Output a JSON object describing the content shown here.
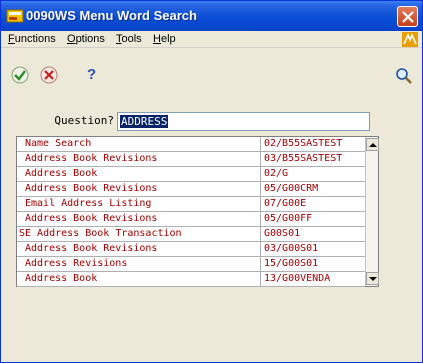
{
  "window": {
    "title": "0090WS   Menu Word Search"
  },
  "menubar": {
    "items": [
      "Functions",
      "Options",
      "Tools",
      "Help"
    ]
  },
  "toolbar": {
    "ok": "checkmark-icon",
    "cancel": "cancel-icon",
    "help": "?",
    "search": "magnifier-icon"
  },
  "question": {
    "label": "Question?",
    "value": "ADDRESS"
  },
  "results": [
    {
      "name": "Name Search",
      "code": "02/B55SASTEST",
      "indent": true
    },
    {
      "name": "Address Book Revisions",
      "code": "03/B55SASTEST",
      "indent": true
    },
    {
      "name": "Address Book",
      "code": "02/G",
      "indent": true
    },
    {
      "name": "Address Book Revisions",
      "code": "05/G00CRM",
      "indent": true
    },
    {
      "name": "Email Address Listing",
      "code": "07/G00E",
      "indent": true
    },
    {
      "name": "Address Book Revisions",
      "code": "05/G00FF",
      "indent": true
    },
    {
      "name": "SE Address Book Transaction",
      "code": "G00S01",
      "indent": false
    },
    {
      "name": "Address Book Revisions",
      "code": "03/G00S01",
      "indent": true
    },
    {
      "name": "Address Revisions",
      "code": "15/G00S01",
      "indent": true
    },
    {
      "name": "Address Book",
      "code": "13/G00VENDA",
      "indent": true
    }
  ],
  "colors": {
    "titlebar": "#0a4fd6",
    "row_text": "#a00000",
    "selection": "#0a246a"
  }
}
